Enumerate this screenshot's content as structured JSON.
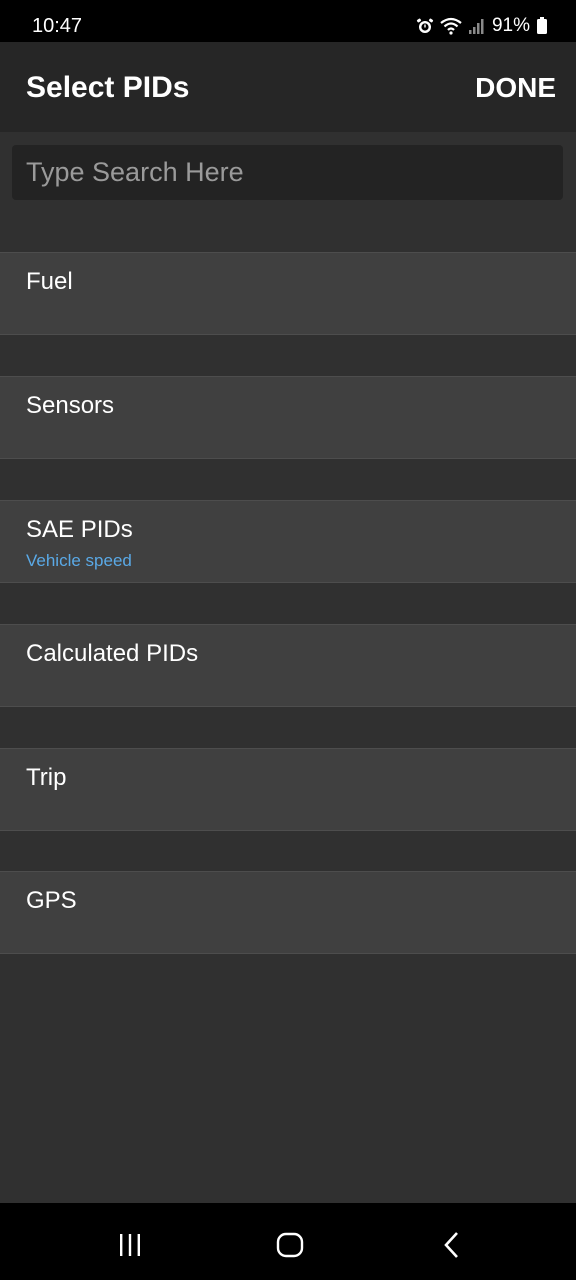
{
  "status_bar": {
    "time": "10:47",
    "battery": "91%",
    "icons": [
      "alarm-icon",
      "wifi-icon",
      "signal-icon",
      "battery-icon"
    ]
  },
  "header": {
    "title": "Select PIDs",
    "done_label": "DONE"
  },
  "search": {
    "placeholder": "Type Search Here",
    "value": ""
  },
  "categories": [
    {
      "label": "Fuel",
      "subtitle": ""
    },
    {
      "label": "Sensors",
      "subtitle": ""
    },
    {
      "label": "SAE PIDs",
      "subtitle": "Vehicle speed"
    },
    {
      "label": "Calculated PIDs",
      "subtitle": ""
    },
    {
      "label": "Trip",
      "subtitle": ""
    },
    {
      "label": "GPS",
      "subtitle": ""
    }
  ],
  "nav_bar": {
    "icons": [
      "recent-apps-icon",
      "home-icon",
      "back-icon"
    ]
  },
  "colors": {
    "background": "#303030",
    "header": "#262626",
    "row": "#404040",
    "subtitle": "#5aa9e6"
  }
}
